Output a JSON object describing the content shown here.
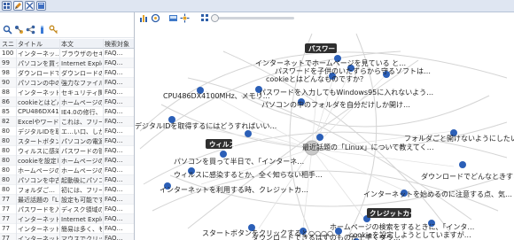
{
  "grid": {
    "headers": [
      "スニ",
      "タイトル",
      "本文",
      "検索対象"
    ],
    "rows": [
      [
        "100",
        "インターネッ…",
        "ブラウザのセキュ…",
        "FAQ…"
      ],
      [
        "99",
        "パソコンを買っ…",
        "Internet Explorer（IE…",
        "FAQ…"
      ],
      [
        "98",
        "ダウンロードで…",
        "ダウンロードの際…",
        "FAQ…"
      ],
      [
        "90",
        "パソコンの中の…",
        "強力なファイル暗…",
        "FAQ…"
      ],
      [
        "88",
        "インターネット…",
        "セキュリティ関連…",
        "FAQ…"
      ],
      [
        "86",
        "cookieとはどん…",
        "ホームページの訪…",
        "FAQ…"
      ],
      [
        "85",
        "CPU486DX4100…",
        "IE4.0の修行、いろ…",
        "FAQ…"
      ],
      [
        "82",
        "Excelやワード…",
        "これは、フリーウ…",
        "FAQ…"
      ],
      [
        "80",
        "デジタルIDを取…",
        "エ…い口、しかし…",
        "FAQ…"
      ],
      [
        "80",
        "スタートボタン…",
        "パソコンの電源を…",
        "FAQ…"
      ],
      [
        "80",
        "ウィルスに感染…",
        "パスワードの管理…",
        "FAQ…"
      ],
      [
        "80",
        "cookieを設定し…",
        "ホームページのお…",
        "FAQ…"
      ],
      [
        "80",
        "ホームページの…",
        "ホームページの検…",
        "FAQ…"
      ],
      [
        "80",
        "パソコンを中古…",
        "起動後にパソコン…",
        "FAQ…"
      ],
      [
        "80",
        "フォルダご…",
        "初には、フリーウ…",
        "FAQ…"
      ],
      [
        "77",
        "最近話題の「Lin…",
        "設定も可能です。…",
        "FAQ…"
      ],
      [
        "77",
        "パスワードを入…",
        "ディスク領域の確…",
        "FAQ…"
      ],
      [
        "77",
        "インターネット…",
        "Internet Explorer（I…",
        "FAQ…"
      ],
      [
        "77",
        "インターネット…",
        "簡易は多く、もし…",
        "FAQ…"
      ],
      [
        "77",
        "インターネット…",
        "マウスでクリック…",
        "FAQ…"
      ]
    ]
  },
  "tags": {
    "password": "パスワード",
    "virus": "ウィルス",
    "credit": "クレジットカード"
  },
  "labels": {
    "n1": "インターネットでホームページを見ている と…",
    "n2": "パスワードを子供のいたずらから守るソフトは…",
    "n3": "cookieとはどんなものですか？",
    "n4": "CPU486DX4100MHz、メモリ…",
    "n5": "パスワードを入力してもWindows95に入れないよう…",
    "n6": "パソコンの中のフォルダを自分だけしか開け…",
    "n7": "デジタルIDを取得するにはどうすればいい…",
    "n8": "フォルダご…",
    "n9": "フォルダご…",
    "n10": "フォルダご…",
    "n11": "最近話題の「Linux」について教えてく…",
    "n12": "フォルダごと開けないようにしたい、どうし…",
    "n13": "パソコンを買って半日で、「インターネ…",
    "n14": "ウィルスに感染するとか、全く知らない相手…",
    "n15": "インターネットを利用する時、クレジットカ…",
    "n16": "ダウンロードでどんなときするのです…",
    "n17": "インターネットを始めるのに注意する点、気…",
    "n18": "スタートボタンをクリックすると○○○○…",
    "n19": "ダウンロードできるはずのものが上手くダウ…",
    "n20": "ホームページの検索をするときに、「インタ…",
    "n21": "cookieを設定しようとしていますが…"
  }
}
